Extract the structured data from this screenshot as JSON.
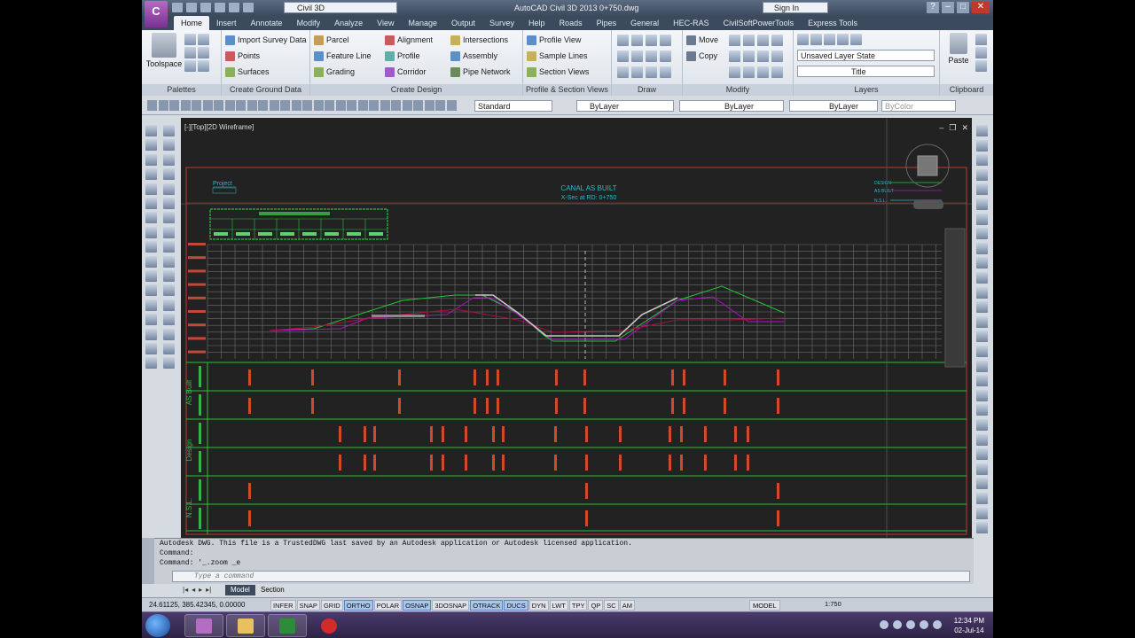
{
  "app": {
    "letter": "C",
    "workspace": "Civil 3D",
    "title": "AutoCAD Civil 3D 2013    0+750.dwg",
    "signin": "Sign In"
  },
  "ribbon_tabs": [
    "Home",
    "Insert",
    "Annotate",
    "Modify",
    "Analyze",
    "View",
    "Manage",
    "Output",
    "Survey",
    "Help",
    "Roads",
    "Pipes",
    "General",
    "HEC-RAS",
    "CivilSoftPowerTools",
    "Express Tools"
  ],
  "ribbon": {
    "palettes": {
      "title": "Palettes",
      "toolspace": "Toolspace"
    },
    "ground": {
      "title": "Create Ground Data",
      "items": [
        "Import Survey Data",
        "Points",
        "Surfaces"
      ]
    },
    "design": {
      "title": "Create Design",
      "col1": [
        "Parcel",
        "Feature Line",
        "Grading"
      ],
      "col2": [
        "Alignment",
        "Profile",
        "Corridor"
      ],
      "col3": [
        "Intersections",
        "Assembly",
        "Pipe Network"
      ]
    },
    "profile": {
      "title": "Profile & Section Views",
      "items": [
        "Profile View",
        "Sample Lines",
        "Section Views"
      ]
    },
    "draw": {
      "title": "Draw"
    },
    "modify": {
      "title": "Modify",
      "move": "Move",
      "copy": "Copy"
    },
    "layers": {
      "title": "Layers",
      "state": "Unsaved Layer State",
      "current": "Title"
    },
    "clipboard": {
      "title": "Clipboard",
      "paste": "Paste"
    }
  },
  "properties": {
    "style": "Standard",
    "layer": "ByLayer",
    "linetype": "ByLayer",
    "lineweight": "ByLayer",
    "color": "ByColor"
  },
  "viewport": {
    "label": "[-][Top][2D Wireframe]"
  },
  "drawing": {
    "title": "CANAL AS BUILT",
    "subtitle": "X-Sec at RD: 0+750",
    "project_tag": "Project",
    "legend": [
      "DESIGN",
      "AS BUILT",
      "N.S.L."
    ],
    "section_groups": [
      "AS Built",
      "Design",
      "N.S.L."
    ]
  },
  "command": {
    "lines": [
      "Autodesk DWG.  This file is a TrustedDWG last saved by an Autodesk application or Autodesk licensed application.",
      "Command:",
      "Command: '_.zoom _e"
    ],
    "placeholder": "Type a command"
  },
  "layout_tabs": [
    "Model",
    "Section"
  ],
  "status": {
    "coords": "24.61125, 385.42345, 0.00000",
    "toggles": [
      {
        "label": "INFER",
        "on": false
      },
      {
        "label": "SNAP",
        "on": false
      },
      {
        "label": "GRID",
        "on": false
      },
      {
        "label": "ORTHO",
        "on": true
      },
      {
        "label": "POLAR",
        "on": false
      },
      {
        "label": "OSNAP",
        "on": true
      },
      {
        "label": "3DOSNAP",
        "on": false
      },
      {
        "label": "OTRACK",
        "on": true
      },
      {
        "label": "DUCS",
        "on": true
      },
      {
        "label": "DYN",
        "on": false
      },
      {
        "label": "LWT",
        "on": false
      },
      {
        "label": "TPY",
        "on": false
      },
      {
        "label": "QP",
        "on": false
      },
      {
        "label": "SC",
        "on": false
      },
      {
        "label": "AM",
        "on": false
      }
    ],
    "model": "MODEL",
    "scale": "1:750"
  },
  "taskbar": {
    "time": "12:34 PM",
    "date": "02-Jul-14"
  },
  "colors": {
    "frame": "#c0392b",
    "grid": "#7a7a7a",
    "green": "#27c23c",
    "magenta": "#b010c8",
    "cyan": "#30b8c8",
    "text_red": "#d04a2a"
  }
}
